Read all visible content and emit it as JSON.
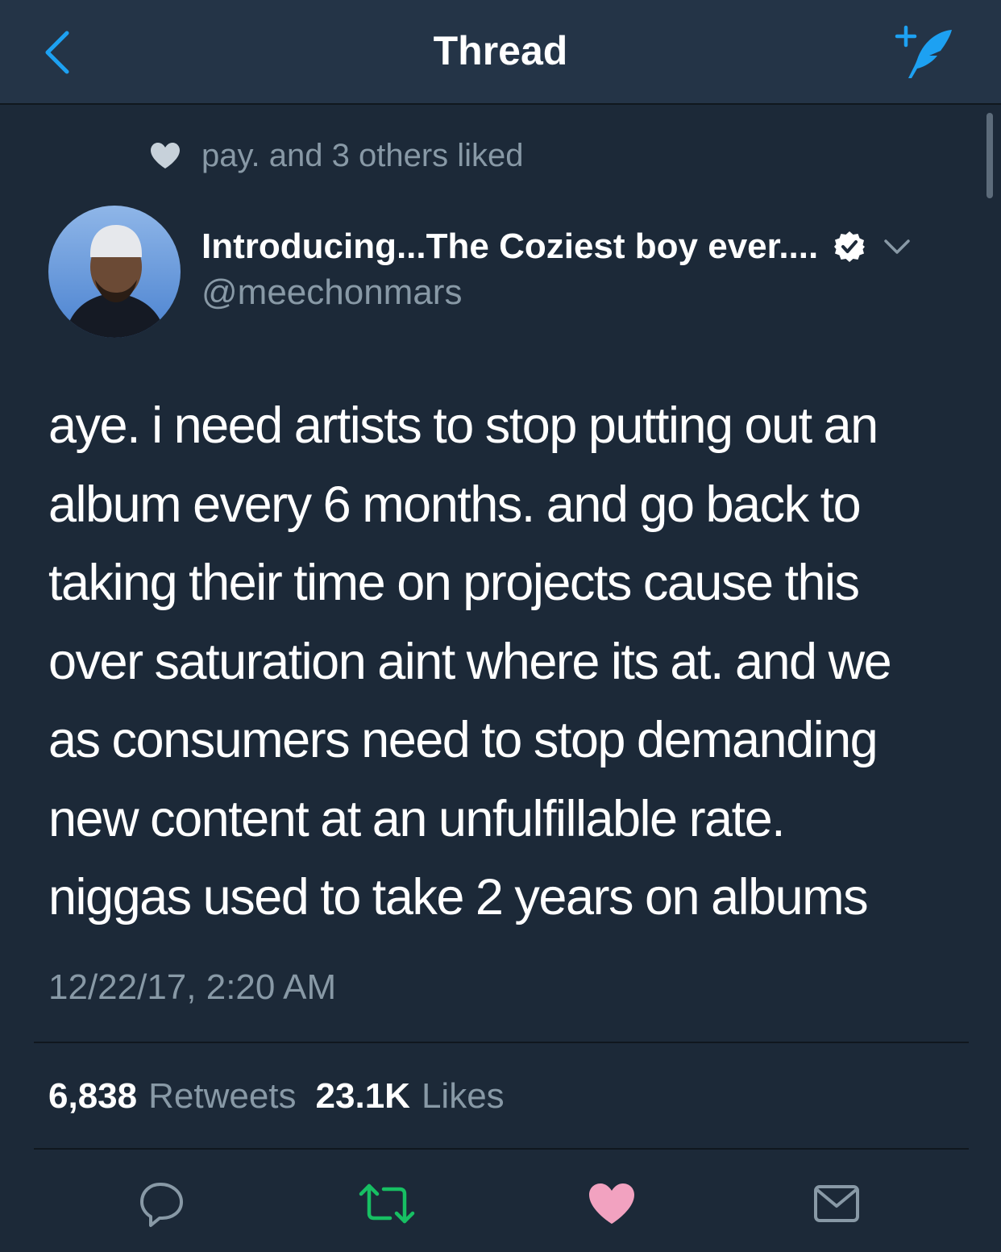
{
  "navbar": {
    "title": "Thread",
    "back_icon": "chevron-left-icon",
    "compose_icon": "compose-tweet-icon"
  },
  "social_context": {
    "icon": "heart-icon",
    "text": "pay. and 3 others liked"
  },
  "author": {
    "name": "Introducing...The Coziest boy ever....",
    "handle": "@meechonmars",
    "verified": true
  },
  "tweet": {
    "lines": [
      "aye. i need artists to stop putting out an",
      "album every 6 months. and go back to",
      "taking their time on projects cause this",
      "over saturation aint where its at. and we",
      "as consumers need to stop demanding",
      "new content at an unfulfillable rate.",
      "niggas used to take 2 years on albums"
    ],
    "timestamp": "12/22/17, 2:20 AM"
  },
  "stats": {
    "retweets_count": "6,838",
    "retweets_label": "Retweets",
    "likes_count": "23.1K",
    "likes_label": "Likes"
  },
  "actions": {
    "reply_icon": "reply-icon",
    "retweet_icon": "retweet-icon",
    "like_icon": "heart-icon",
    "dm_icon": "envelope-icon"
  },
  "colors": {
    "background": "#1c2938",
    "navbar": "#243447",
    "secondary_text": "#8899a6",
    "accent": "#1da1f2",
    "retweet_active": "#17bf63",
    "like_active": "#f2a2c0"
  }
}
